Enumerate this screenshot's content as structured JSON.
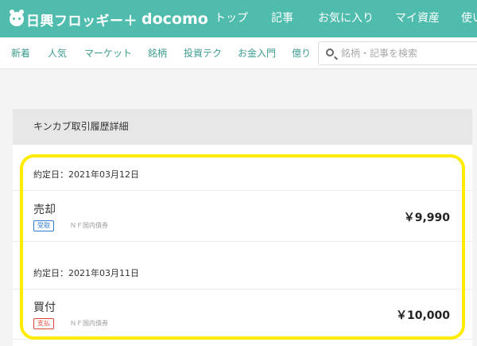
{
  "header": {
    "logo_text": "日興フロッギー＋",
    "logo_partner": "docomo",
    "nav": [
      {
        "label": "トップ"
      },
      {
        "label": "記事"
      },
      {
        "label": "お気に入り"
      },
      {
        "label": "マイ資産"
      },
      {
        "label": "使い"
      }
    ]
  },
  "subnav": {
    "items": [
      {
        "label": "新着"
      },
      {
        "label": "人気"
      },
      {
        "label": "マーケット"
      },
      {
        "label": "銘柄"
      },
      {
        "label": "投資テク"
      },
      {
        "label": "お金入門"
      },
      {
        "label": "億り"
      }
    ],
    "search_placeholder": "銘柄・記事を検索"
  },
  "panel": {
    "title": "キンカブ取引履歴詳細",
    "entries": [
      {
        "date_label": "約定日：2021年03月12日",
        "type": "売却",
        "badge": "受取",
        "badge_color": "#2f7bd6",
        "fund": "ＮＦ国内債券",
        "amount": "￥9,990"
      },
      {
        "date_label": "約定日：2021年03月11日",
        "type": "買付",
        "badge": "支払",
        "badge_color": "#e0483b",
        "fund": "ＮＦ国内債券",
        "amount": "￥10,000"
      }
    ]
  },
  "colors": {
    "header_bg": "#4fbcae",
    "subnav_text": "#3d9c8f",
    "highlight": "#ffec00"
  }
}
